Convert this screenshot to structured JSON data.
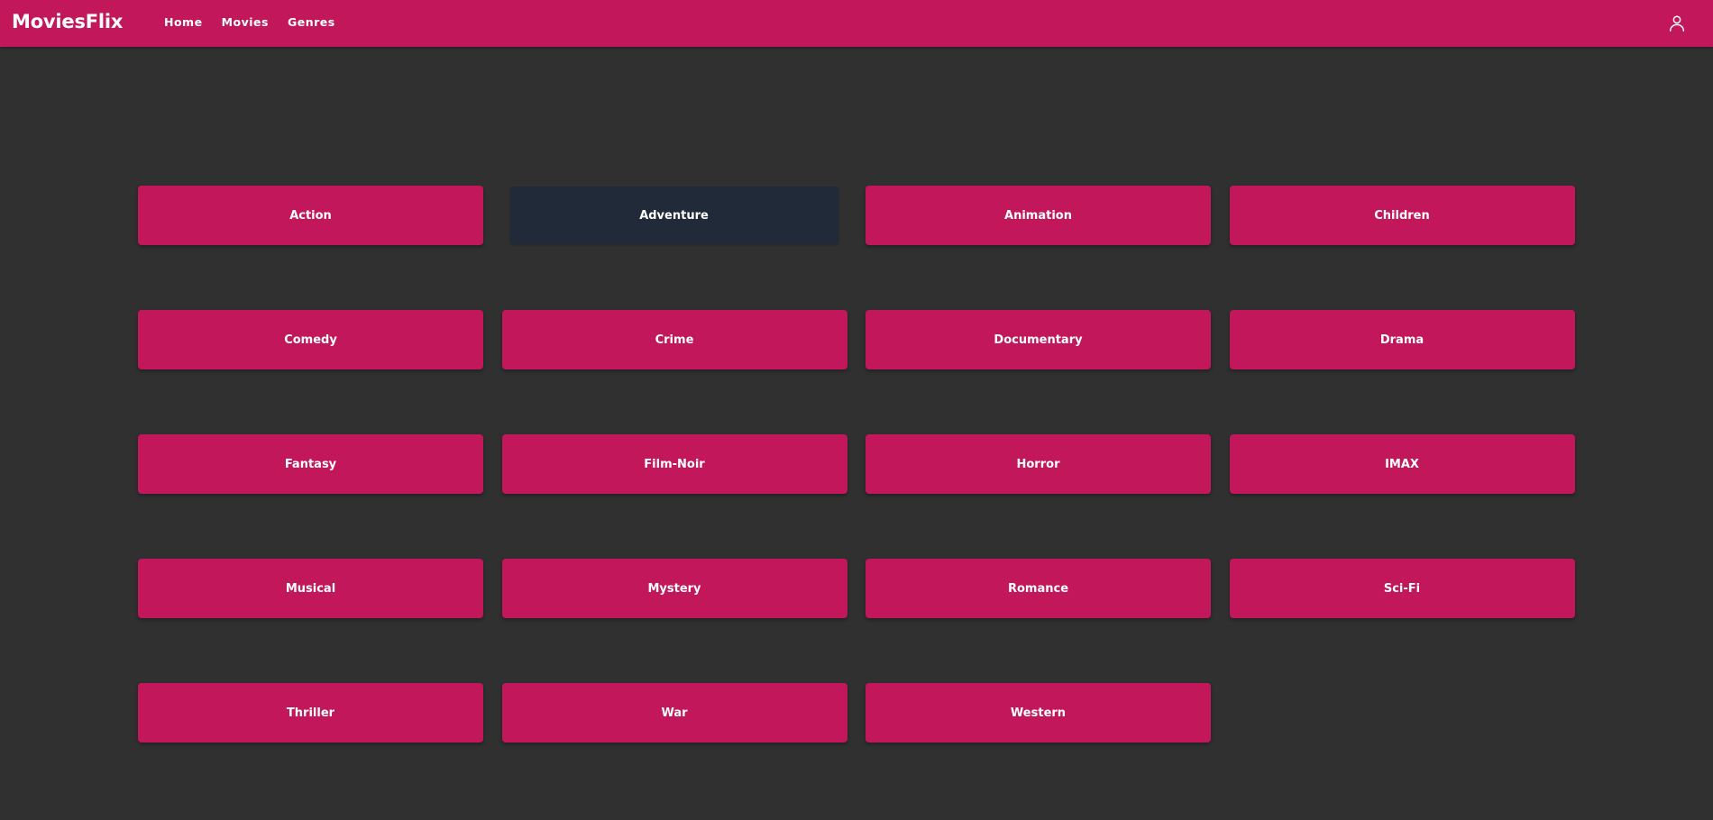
{
  "header": {
    "brand": "MoviesFlix",
    "nav": [
      "Home",
      "Movies",
      "Genres"
    ],
    "user_icon": "user-icon"
  },
  "genres": [
    "Action",
    "Adventure",
    "Animation",
    "Children",
    "Comedy",
    "Crime",
    "Documentary",
    "Drama",
    "Fantasy",
    "Film-Noir",
    "Horror",
    "IMAX",
    "Musical",
    "Mystery",
    "Romance",
    "Sci-Fi",
    "Thriller",
    "War",
    "Western"
  ],
  "highlighted_genre": "Adventure",
  "colors": {
    "primary": "#c2185b",
    "background": "#303030",
    "highlight": "#212a38",
    "text": "#ffffff"
  }
}
